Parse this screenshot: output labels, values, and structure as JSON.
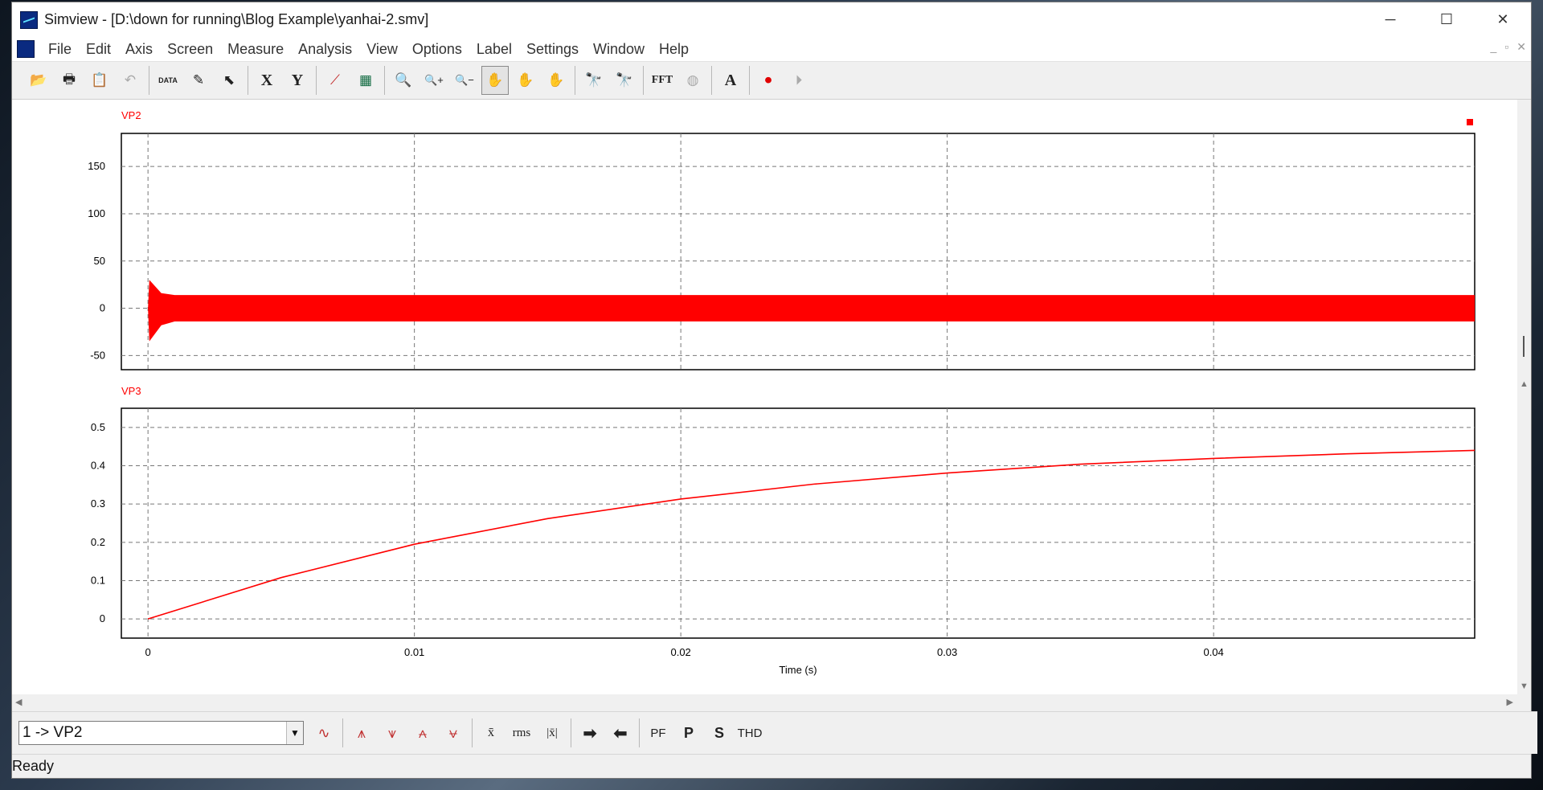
{
  "window": {
    "title": "Simview - [D:\\down for running\\Blog Example\\yanhai-2.smv]",
    "controls": [
      "─",
      "☐",
      "✕"
    ]
  },
  "menu": {
    "items": [
      "File",
      "Edit",
      "Axis",
      "Screen",
      "Measure",
      "Analysis",
      "View",
      "Options",
      "Label",
      "Settings",
      "Window",
      "Help"
    ],
    "mdi_controls": [
      "_",
      "▫",
      "✕"
    ]
  },
  "toolbar": {
    "buttons": [
      {
        "name": "open-icon",
        "glyph": "📂"
      },
      {
        "name": "print-icon",
        "glyph": "🖶"
      },
      {
        "name": "clipboard-icon",
        "glyph": "📋"
      },
      {
        "name": "undo-icon",
        "glyph": "↶"
      },
      {
        "name": "data-icon",
        "glyph": "DATA"
      },
      {
        "name": "edit-curve-icon",
        "glyph": "✎"
      },
      {
        "name": "pointer-icon",
        "glyph": "⬉"
      },
      {
        "name": "x-axis-icon",
        "glyph": "X"
      },
      {
        "name": "y-axis-icon",
        "glyph": "Y"
      },
      {
        "name": "graph-icon",
        "glyph": "⟋"
      },
      {
        "name": "screen-icon",
        "glyph": "▦"
      },
      {
        "name": "zoom-icon",
        "glyph": "🔍"
      },
      {
        "name": "zoom-in-icon",
        "glyph": "🔍+"
      },
      {
        "name": "zoom-out-icon",
        "glyph": "🔍−"
      },
      {
        "name": "pan-icon",
        "glyph": "✋"
      },
      {
        "name": "pan-min-icon",
        "glyph": "✋"
      },
      {
        "name": "pan-max-icon",
        "glyph": "✋"
      },
      {
        "name": "telescope-icon",
        "glyph": "🔭"
      },
      {
        "name": "telescope-disabled-icon",
        "glyph": "🔭"
      },
      {
        "name": "fft-icon",
        "glyph": "FFT"
      },
      {
        "name": "fft-disabled-icon",
        "glyph": "◍"
      },
      {
        "name": "text-icon",
        "glyph": "A"
      },
      {
        "name": "record-icon",
        "glyph": "⏺"
      },
      {
        "name": "record-disabled-icon",
        "glyph": "⏵"
      }
    ]
  },
  "bottombar": {
    "curve_selector": "1 -> VP2",
    "buttons": [
      "∿",
      "⩚",
      "⩛",
      "⩜",
      "⩝",
      "x̄",
      "rms",
      "|x̄|",
      "➡",
      "⬅",
      "PF",
      "P",
      "S",
      "THD"
    ]
  },
  "status": {
    "text": "Ready"
  },
  "colors": {
    "trace": "#ff0000",
    "grid": "#777777",
    "title_text": "#ff0000"
  },
  "chart_data": [
    {
      "type": "line",
      "title": "VP2",
      "xlabel": "",
      "ylabel": "",
      "xlim": [
        -0.001,
        0.0498
      ],
      "ylim": [
        -65,
        185
      ],
      "yticks": [
        150,
        100,
        50,
        0,
        -50
      ],
      "xticks": [
        0,
        0.01,
        0.02,
        0.03,
        0.04
      ],
      "series": [
        {
          "name": "VP2",
          "envelope_top": [
            [
              0,
              0
            ],
            [
              5e-05,
              30
            ],
            [
              0.0005,
              16
            ],
            [
              0.001,
              14
            ],
            [
              0.0498,
              14
            ]
          ],
          "envelope_bottom": [
            [
              0,
              0
            ],
            [
              5e-05,
              -35
            ],
            [
              0.0005,
              -18
            ],
            [
              0.001,
              -14
            ],
            [
              0.0498,
              -14
            ]
          ]
        }
      ]
    },
    {
      "type": "line",
      "title": "VP3",
      "xlabel": "Time (s)",
      "ylabel": "",
      "xlim": [
        -0.001,
        0.0498
      ],
      "ylim": [
        -0.05,
        0.55
      ],
      "yticks": [
        0.5,
        0.4,
        0.3,
        0.2,
        0.1,
        0
      ],
      "xticks": [
        0,
        0.01,
        0.02,
        0.03,
        0.04
      ],
      "xtick_labels": [
        "0",
        "0.01",
        "0.02",
        "0.03",
        "0.04"
      ],
      "series": [
        {
          "name": "VP3",
          "x": [
            0,
            0.005,
            0.01,
            0.015,
            0.02,
            0.025,
            0.03,
            0.035,
            0.04,
            0.045,
            0.0498
          ],
          "y": [
            0,
            0.108,
            0.195,
            0.262,
            0.313,
            0.352,
            0.381,
            0.404,
            0.419,
            0.431,
            0.44
          ]
        }
      ]
    }
  ]
}
